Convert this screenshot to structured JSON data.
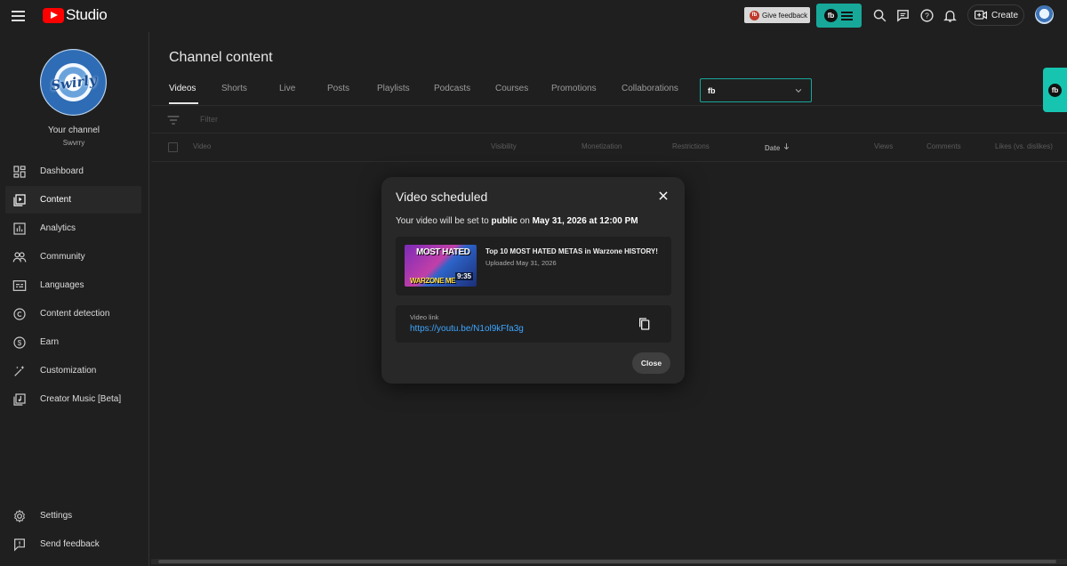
{
  "header": {
    "app_name": "Studio",
    "give_feedback": "Give feedback",
    "fb_mark": "fb",
    "create_label": "Create"
  },
  "sidebar": {
    "channel_avatar_text": "Swirly",
    "channel_title": "Your channel",
    "channel_handle": "Swvrry",
    "items": [
      {
        "label": "Dashboard",
        "icon": "dashboard-icon"
      },
      {
        "label": "Content",
        "icon": "content-icon",
        "active": true
      },
      {
        "label": "Analytics",
        "icon": "analytics-icon"
      },
      {
        "label": "Community",
        "icon": "community-icon"
      },
      {
        "label": "Languages",
        "icon": "languages-icon"
      },
      {
        "label": "Content detection",
        "icon": "copyright-icon"
      },
      {
        "label": "Earn",
        "icon": "earn-icon"
      },
      {
        "label": "Customization",
        "icon": "customization-icon"
      },
      {
        "label": "Creator Music [Beta]",
        "icon": "creator-music-icon"
      }
    ],
    "bottom_items": [
      {
        "label": "Settings",
        "icon": "gear-icon"
      },
      {
        "label": "Send feedback",
        "icon": "feedback-icon"
      }
    ]
  },
  "main": {
    "page_title": "Channel content",
    "tabs": [
      "Videos",
      "Shorts",
      "Live",
      "Posts",
      "Playlists",
      "Podcasts",
      "Courses",
      "Promotions",
      "Collaborations"
    ],
    "active_tab": "Videos",
    "fb_select_mark": "fb",
    "filter_placeholder": "Filter",
    "columns": [
      "Video",
      "Visibility",
      "Monetization",
      "Restrictions",
      "Date",
      "Views",
      "Comments",
      "Likes (vs. dislikes)"
    ],
    "sorted_column": "Date"
  },
  "dialog": {
    "title": "Video scheduled",
    "message_prefix": "Your video will be set to ",
    "visibility": "public",
    "message_mid": " on ",
    "scheduled_time": "May 31, 2026 at 12:00 PM",
    "video": {
      "title": "Top 10 MOST HATED METAS in Warzone HISTORY!",
      "uploaded": "Uploaded May 31, 2026",
      "thumb_line1": "MOST HATED",
      "thumb_line2": "WARZONE ME",
      "duration": "9:35"
    },
    "link_label": "Video link",
    "link_url": "https://youtu.be/N1ol9kFfa3g",
    "close_label": "Close"
  },
  "colors": {
    "accent_teal": "#17a89a",
    "link_blue": "#3ea6ff",
    "brand_red": "#ff0000"
  }
}
